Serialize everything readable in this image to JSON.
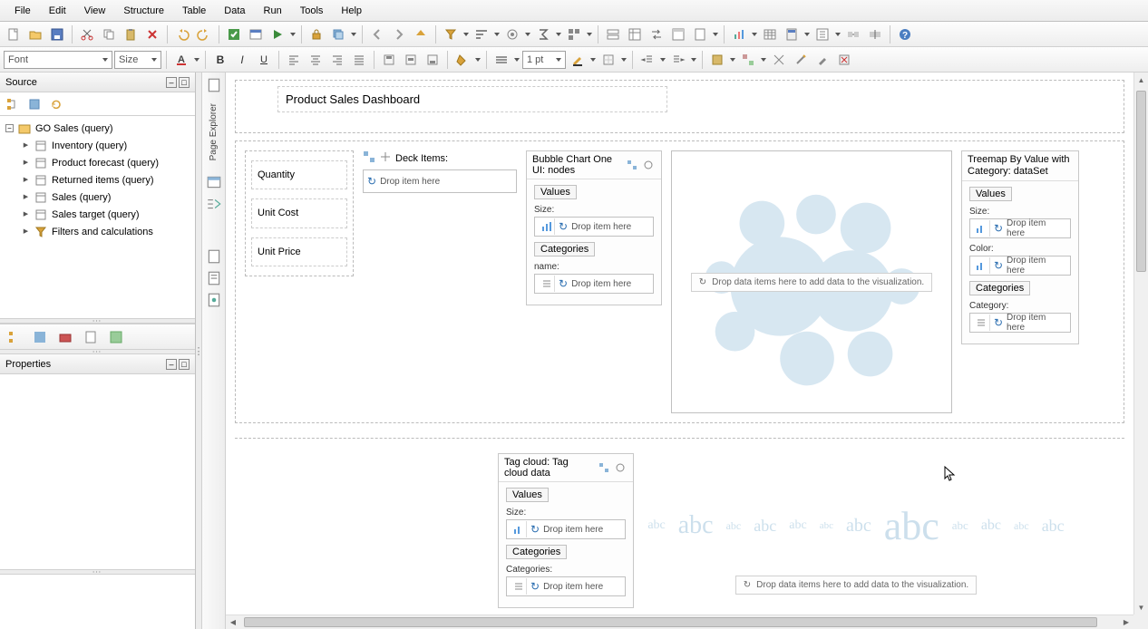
{
  "menu": {
    "file": "File",
    "edit": "Edit",
    "view": "View",
    "structure": "Structure",
    "table": "Table",
    "data": "Data",
    "run": "Run",
    "tools": "Tools",
    "help": "Help"
  },
  "format": {
    "font_placeholder": "Font",
    "size_placeholder": "Size",
    "pt": "1 pt"
  },
  "source": {
    "title": "Source",
    "root": "GO Sales (query)",
    "children": [
      "Inventory (query)",
      "Product forecast (query)",
      "Returned items (query)",
      "Sales (query)",
      "Sales target (query)",
      "Filters and calculations"
    ]
  },
  "properties": {
    "title": "Properties"
  },
  "explorer": {
    "label": "Page Explorer"
  },
  "dashboard": {
    "title": "Product Sales Dashboard",
    "fields": [
      "Quantity",
      "Unit Cost",
      "Unit Price"
    ]
  },
  "deck": {
    "title": "Deck Items:",
    "drop": "Drop item here"
  },
  "bubble": {
    "title": "Bubble Chart One UI: nodes",
    "values": "Values",
    "size": "Size:",
    "categories": "Categories",
    "name": "name:",
    "drop": "Drop item here",
    "hint": "Drop data items here to add data to the visualization."
  },
  "treemap": {
    "title": "Treemap By Value with Category: dataSet",
    "values": "Values",
    "size": "Size:",
    "color": "Color:",
    "categories": "Categories",
    "category": "Category:",
    "drop": "Drop item here"
  },
  "tagcloud": {
    "title": "Tag cloud: Tag cloud data",
    "values": "Values",
    "size": "Size:",
    "categories": "Categories",
    "categories_lbl": "Categories:",
    "drop": "Drop item here",
    "hint": "Drop data items here to add data to the visualization.",
    "abc": "abc"
  }
}
